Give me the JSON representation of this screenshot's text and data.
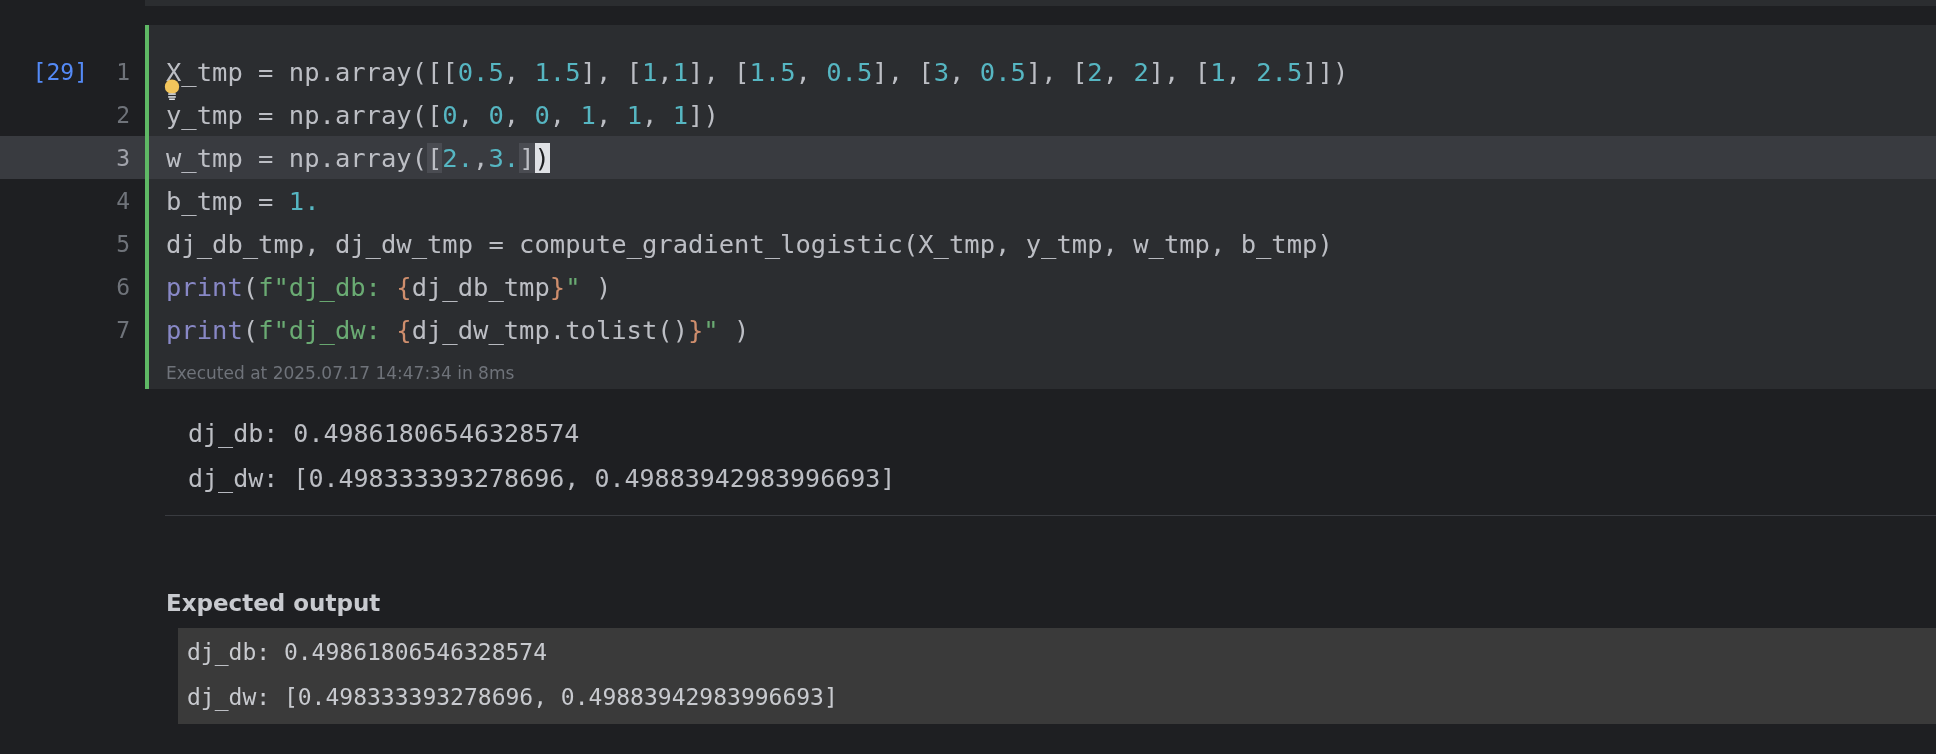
{
  "cell": {
    "execution_count": "[29]",
    "lines": [
      {
        "number": "1",
        "selected": false,
        "tokens": [
          {
            "kind": "plain",
            "text": "X_tmp = np.array([["
          },
          {
            "kind": "num",
            "text": "0.5"
          },
          {
            "kind": "plain",
            "text": ", "
          },
          {
            "kind": "num",
            "text": "1.5"
          },
          {
            "kind": "plain",
            "text": "], ["
          },
          {
            "kind": "num",
            "text": "1"
          },
          {
            "kind": "plain",
            "text": ","
          },
          {
            "kind": "num",
            "text": "1"
          },
          {
            "kind": "plain",
            "text": "], ["
          },
          {
            "kind": "num",
            "text": "1.5"
          },
          {
            "kind": "plain",
            "text": ", "
          },
          {
            "kind": "num",
            "text": "0.5"
          },
          {
            "kind": "plain",
            "text": "], ["
          },
          {
            "kind": "num",
            "text": "3"
          },
          {
            "kind": "plain",
            "text": ", "
          },
          {
            "kind": "num",
            "text": "0.5"
          },
          {
            "kind": "plain",
            "text": "], ["
          },
          {
            "kind": "num",
            "text": "2"
          },
          {
            "kind": "plain",
            "text": ", "
          },
          {
            "kind": "num",
            "text": "2"
          },
          {
            "kind": "plain",
            "text": "], ["
          },
          {
            "kind": "num",
            "text": "1"
          },
          {
            "kind": "plain",
            "text": ", "
          },
          {
            "kind": "num",
            "text": "2.5"
          },
          {
            "kind": "plain",
            "text": "]])"
          }
        ]
      },
      {
        "number": "2",
        "selected": false,
        "tokens": [
          {
            "kind": "plain",
            "text": "y_tmp = np.array(["
          },
          {
            "kind": "num",
            "text": "0"
          },
          {
            "kind": "plain",
            "text": ", "
          },
          {
            "kind": "num",
            "text": "0"
          },
          {
            "kind": "plain",
            "text": ", "
          },
          {
            "kind": "num",
            "text": "0"
          },
          {
            "kind": "plain",
            "text": ", "
          },
          {
            "kind": "num",
            "text": "1"
          },
          {
            "kind": "plain",
            "text": ", "
          },
          {
            "kind": "num",
            "text": "1"
          },
          {
            "kind": "plain",
            "text": ", "
          },
          {
            "kind": "num",
            "text": "1"
          },
          {
            "kind": "plain",
            "text": "])"
          }
        ]
      },
      {
        "number": "3",
        "selected": true,
        "tokens": [
          {
            "kind": "plain",
            "text": "w_tmp = np.array("
          },
          {
            "kind": "match",
            "text": "["
          },
          {
            "kind": "num",
            "text": "2."
          },
          {
            "kind": "plain",
            "text": ","
          },
          {
            "kind": "num",
            "text": "3."
          },
          {
            "kind": "match",
            "text": "]"
          },
          {
            "kind": "cursor",
            "text": ")"
          }
        ]
      },
      {
        "number": "4",
        "selected": false,
        "tokens": [
          {
            "kind": "plain",
            "text": "b_tmp = "
          },
          {
            "kind": "num",
            "text": "1."
          }
        ]
      },
      {
        "number": "5",
        "selected": false,
        "tokens": [
          {
            "kind": "plain",
            "text": "dj_db_tmp, dj_dw_tmp = compute_gradient_logistic(X_tmp, y_tmp, w_tmp, b_tmp)"
          }
        ]
      },
      {
        "number": "6",
        "selected": false,
        "tokens": [
          {
            "kind": "builtin",
            "text": "print"
          },
          {
            "kind": "plain",
            "text": "("
          },
          {
            "kind": "str",
            "text": "f\"dj_db: "
          },
          {
            "kind": "brace",
            "text": "{"
          },
          {
            "kind": "plain",
            "text": "dj_db_tmp"
          },
          {
            "kind": "brace",
            "text": "}"
          },
          {
            "kind": "str",
            "text": "\""
          },
          {
            "kind": "plain",
            "text": " )"
          }
        ]
      },
      {
        "number": "7",
        "selected": false,
        "tokens": [
          {
            "kind": "builtin",
            "text": "print"
          },
          {
            "kind": "plain",
            "text": "("
          },
          {
            "kind": "str",
            "text": "f\"dj_dw: "
          },
          {
            "kind": "brace",
            "text": "{"
          },
          {
            "kind": "plain",
            "text": "dj_dw_tmp.tolist()"
          },
          {
            "kind": "brace",
            "text": "}"
          },
          {
            "kind": "str",
            "text": "\""
          },
          {
            "kind": "plain",
            "text": " )"
          }
        ]
      }
    ],
    "executed": "Executed at 2025.07.17 14:47:34 in 8ms"
  },
  "output": [
    "dj_db: 0.49861806546328574",
    "dj_dw: [0.498333393278696, 0.49883942983996693]"
  ],
  "expected": {
    "heading": "Expected output",
    "lines": [
      "dj_db: 0.49861806546328574",
      "dj_dw: [0.498333393278696, 0.49883942983996693]"
    ]
  }
}
